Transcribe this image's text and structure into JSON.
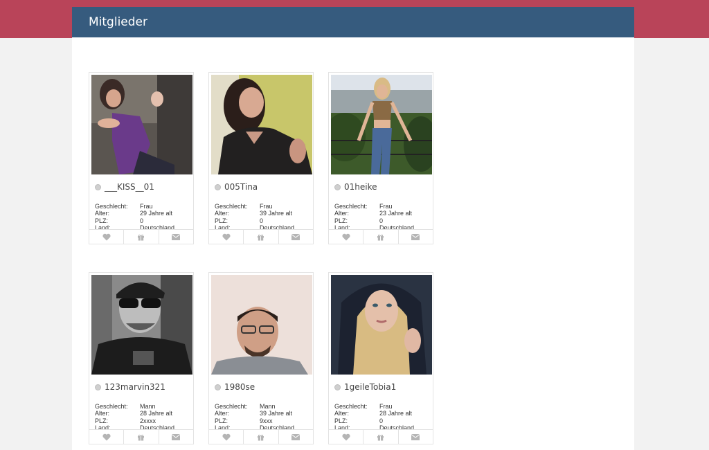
{
  "page": {
    "title": "Mitglieder"
  },
  "labels": {
    "gender": "Geschlecht:",
    "age": "Alter:",
    "zip": "PLZ:",
    "country": "Land:"
  },
  "members": [
    {
      "username": "___KISS__01",
      "gender": "Frau",
      "age": "29 Jahre alt",
      "zip": "0",
      "country": "Deutschland"
    },
    {
      "username": "005Tina",
      "gender": "Frau",
      "age": "39 Jahre alt",
      "zip": "0",
      "country": "Deutschland"
    },
    {
      "username": "01heike",
      "gender": "Frau",
      "age": "23 Jahre alt",
      "zip": "0",
      "country": "Deutschland"
    },
    {
      "username": "123marvin321",
      "gender": "Mann",
      "age": "28 Jahre alt",
      "zip": "2xxxx",
      "country": "Deutschland"
    },
    {
      "username": "1980se",
      "gender": "Mann",
      "age": "39 Jahre alt",
      "zip": "9xxx",
      "country": "Deutschland"
    },
    {
      "username": "1geileTobia1",
      "gender": "Frau",
      "age": "28 Jahre alt",
      "zip": "0",
      "country": "Deutschland"
    }
  ],
  "colors": {
    "topbar": "#b94459",
    "header": "#365b7e",
    "icon": "#b5b5b5"
  },
  "icons": {
    "like": "heart-icon",
    "gift": "gift-icon",
    "message": "envelope-icon",
    "status": "status-dot-icon"
  }
}
